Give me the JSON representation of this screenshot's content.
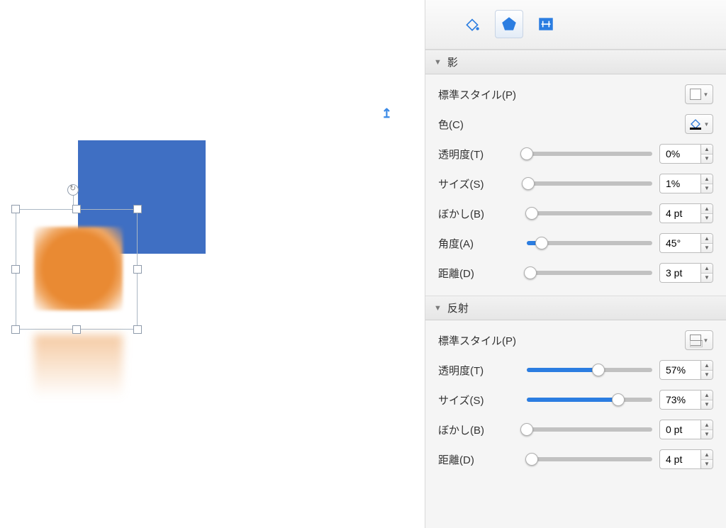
{
  "panel": {
    "tabs": [
      "fill-tab",
      "shape-tab",
      "text-tab"
    ],
    "active_tab": 1,
    "sections": {
      "shadow": {
        "title": "影",
        "style_label": "標準スタイル(P)",
        "color_label": "色(C)",
        "transparency": {
          "label": "透明度(T)",
          "value": "0%",
          "pct": 0
        },
        "size": {
          "label": "サイズ(S)",
          "value": "1%",
          "pct": 1
        },
        "blur": {
          "label": "ぼかし(B)",
          "value": "4 pt",
          "pct": 4
        },
        "angle": {
          "label": "角度(A)",
          "value": "45°",
          "pct": 12
        },
        "distance": {
          "label": "距離(D)",
          "value": "3 pt",
          "pct": 3
        }
      },
      "reflection": {
        "title": "反射",
        "style_label": "標準スタイル(P)",
        "transparency": {
          "label": "透明度(T)",
          "value": "57%",
          "pct": 57
        },
        "size": {
          "label": "サイズ(S)",
          "value": "73%",
          "pct": 73
        },
        "blur": {
          "label": "ぼかし(B)",
          "value": "0 pt",
          "pct": 0
        },
        "distance": {
          "label": "距離(D)",
          "value": "4 pt",
          "pct": 4
        }
      }
    }
  },
  "colors": {
    "blue_shape": "#3f6fc3",
    "orange_shape": "#e98a33",
    "accent": "#2b7de1"
  }
}
